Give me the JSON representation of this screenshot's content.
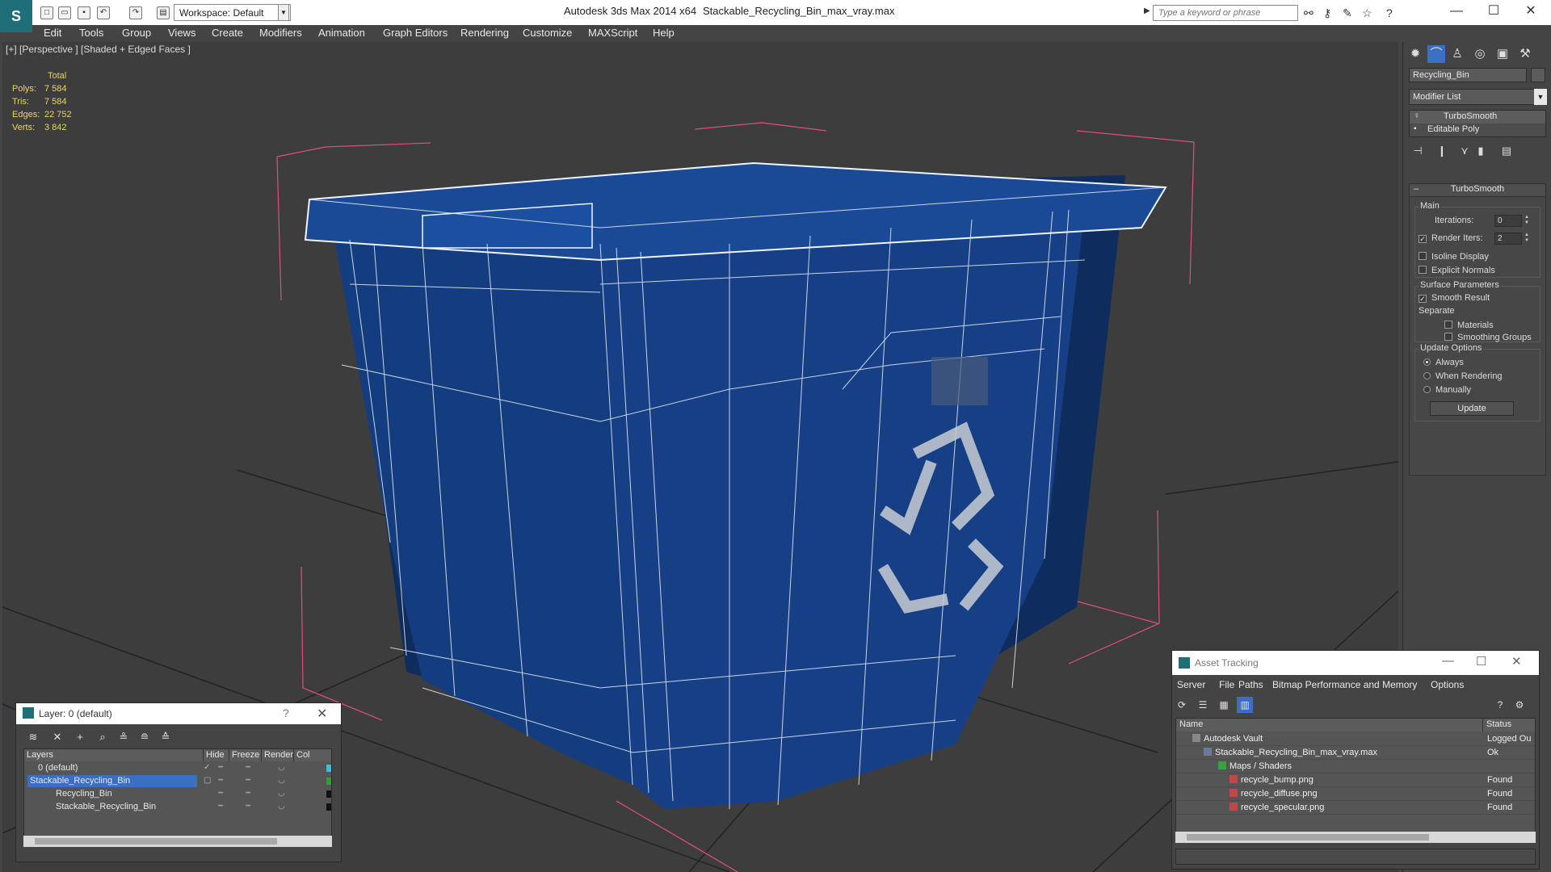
{
  "titlebar": {
    "app_title": "Autodesk 3ds Max  2014 x64",
    "file_title": "Stackable_Recycling_Bin_max_vray.max",
    "workspace_label": "Workspace: Default",
    "search_placeholder": "Type a keyword or phrase"
  },
  "menu": [
    "Edit",
    "Tools",
    "Group",
    "Views",
    "Create",
    "Modifiers",
    "Animation",
    "Graph Editors",
    "Rendering",
    "Customize",
    "MAXScript",
    "Help"
  ],
  "viewport": {
    "label": "[+] [Perspective ] [Shaded + Edged Faces ]",
    "stats": {
      "header": "Total",
      "rows": [
        {
          "label": "Polys:",
          "value": "7 584"
        },
        {
          "label": "Tris:",
          "value": "7 584"
        },
        {
          "label": "Edges:",
          "value": "22 752"
        },
        {
          "label": "Verts:",
          "value": "3 842"
        }
      ]
    },
    "accent_colors": {
      "mesh": "#163f86",
      "wire": "#e8eef8",
      "bbox": "#e0507a",
      "grid": "#1e1e1e"
    }
  },
  "command_panel": {
    "object_name": "Recycling_Bin",
    "modifier_list_label": "Modifier List",
    "stack": [
      "TurboSmooth",
      "Editable Poly"
    ],
    "rollout_title": "TurboSmooth",
    "main": {
      "title": "Main",
      "iterations_label": "Iterations:",
      "iterations_value": "0",
      "render_iters_label": "Render Iters:",
      "render_iters_value": "2",
      "render_iters_checked": true,
      "isoline_label": "Isoline Display",
      "explicit_normals_label": "Explicit Normals"
    },
    "surface": {
      "title": "Surface Parameters",
      "smooth_result_label": "Smooth Result",
      "separate_label": "Separate",
      "materials_label": "Materials",
      "smoothing_groups_label": "Smoothing Groups"
    },
    "update": {
      "title": "Update Options",
      "always_label": "Always",
      "when_rendering_label": "When Rendering",
      "manually_label": "Manually",
      "button_label": "Update"
    }
  },
  "layer_dialog": {
    "title": "Layer: 0 (default)",
    "columns": [
      "Layers",
      "Hide",
      "Freeze",
      "Render",
      "Col"
    ],
    "rows": [
      {
        "name": "0 (default)",
        "color": "#38c0d8"
      },
      {
        "name": "Stackable_Recycling_Bin",
        "color": "#30a030"
      },
      {
        "name": "Recycling_Bin",
        "color": "#111111"
      },
      {
        "name": "Stackable_Recycling_Bin",
        "color": "#111111"
      }
    ]
  },
  "asset_dialog": {
    "title": "Asset Tracking",
    "menu": [
      "Server",
      "File",
      "Paths",
      "Bitmap Performance and Memory",
      "Options"
    ],
    "columns": [
      "Name",
      "Status"
    ],
    "rows": [
      {
        "name": "Autodesk Vault",
        "status": "Logged Ou"
      },
      {
        "name": "Stackable_Recycling_Bin_max_vray.max",
        "status": "Ok"
      },
      {
        "name": "Maps / Shaders",
        "status": ""
      },
      {
        "name": "recycle_bump.png",
        "status": "Found"
      },
      {
        "name": "recycle_diffuse.png",
        "status": "Found"
      },
      {
        "name": "recycle_specular.png",
        "status": "Found"
      }
    ]
  }
}
